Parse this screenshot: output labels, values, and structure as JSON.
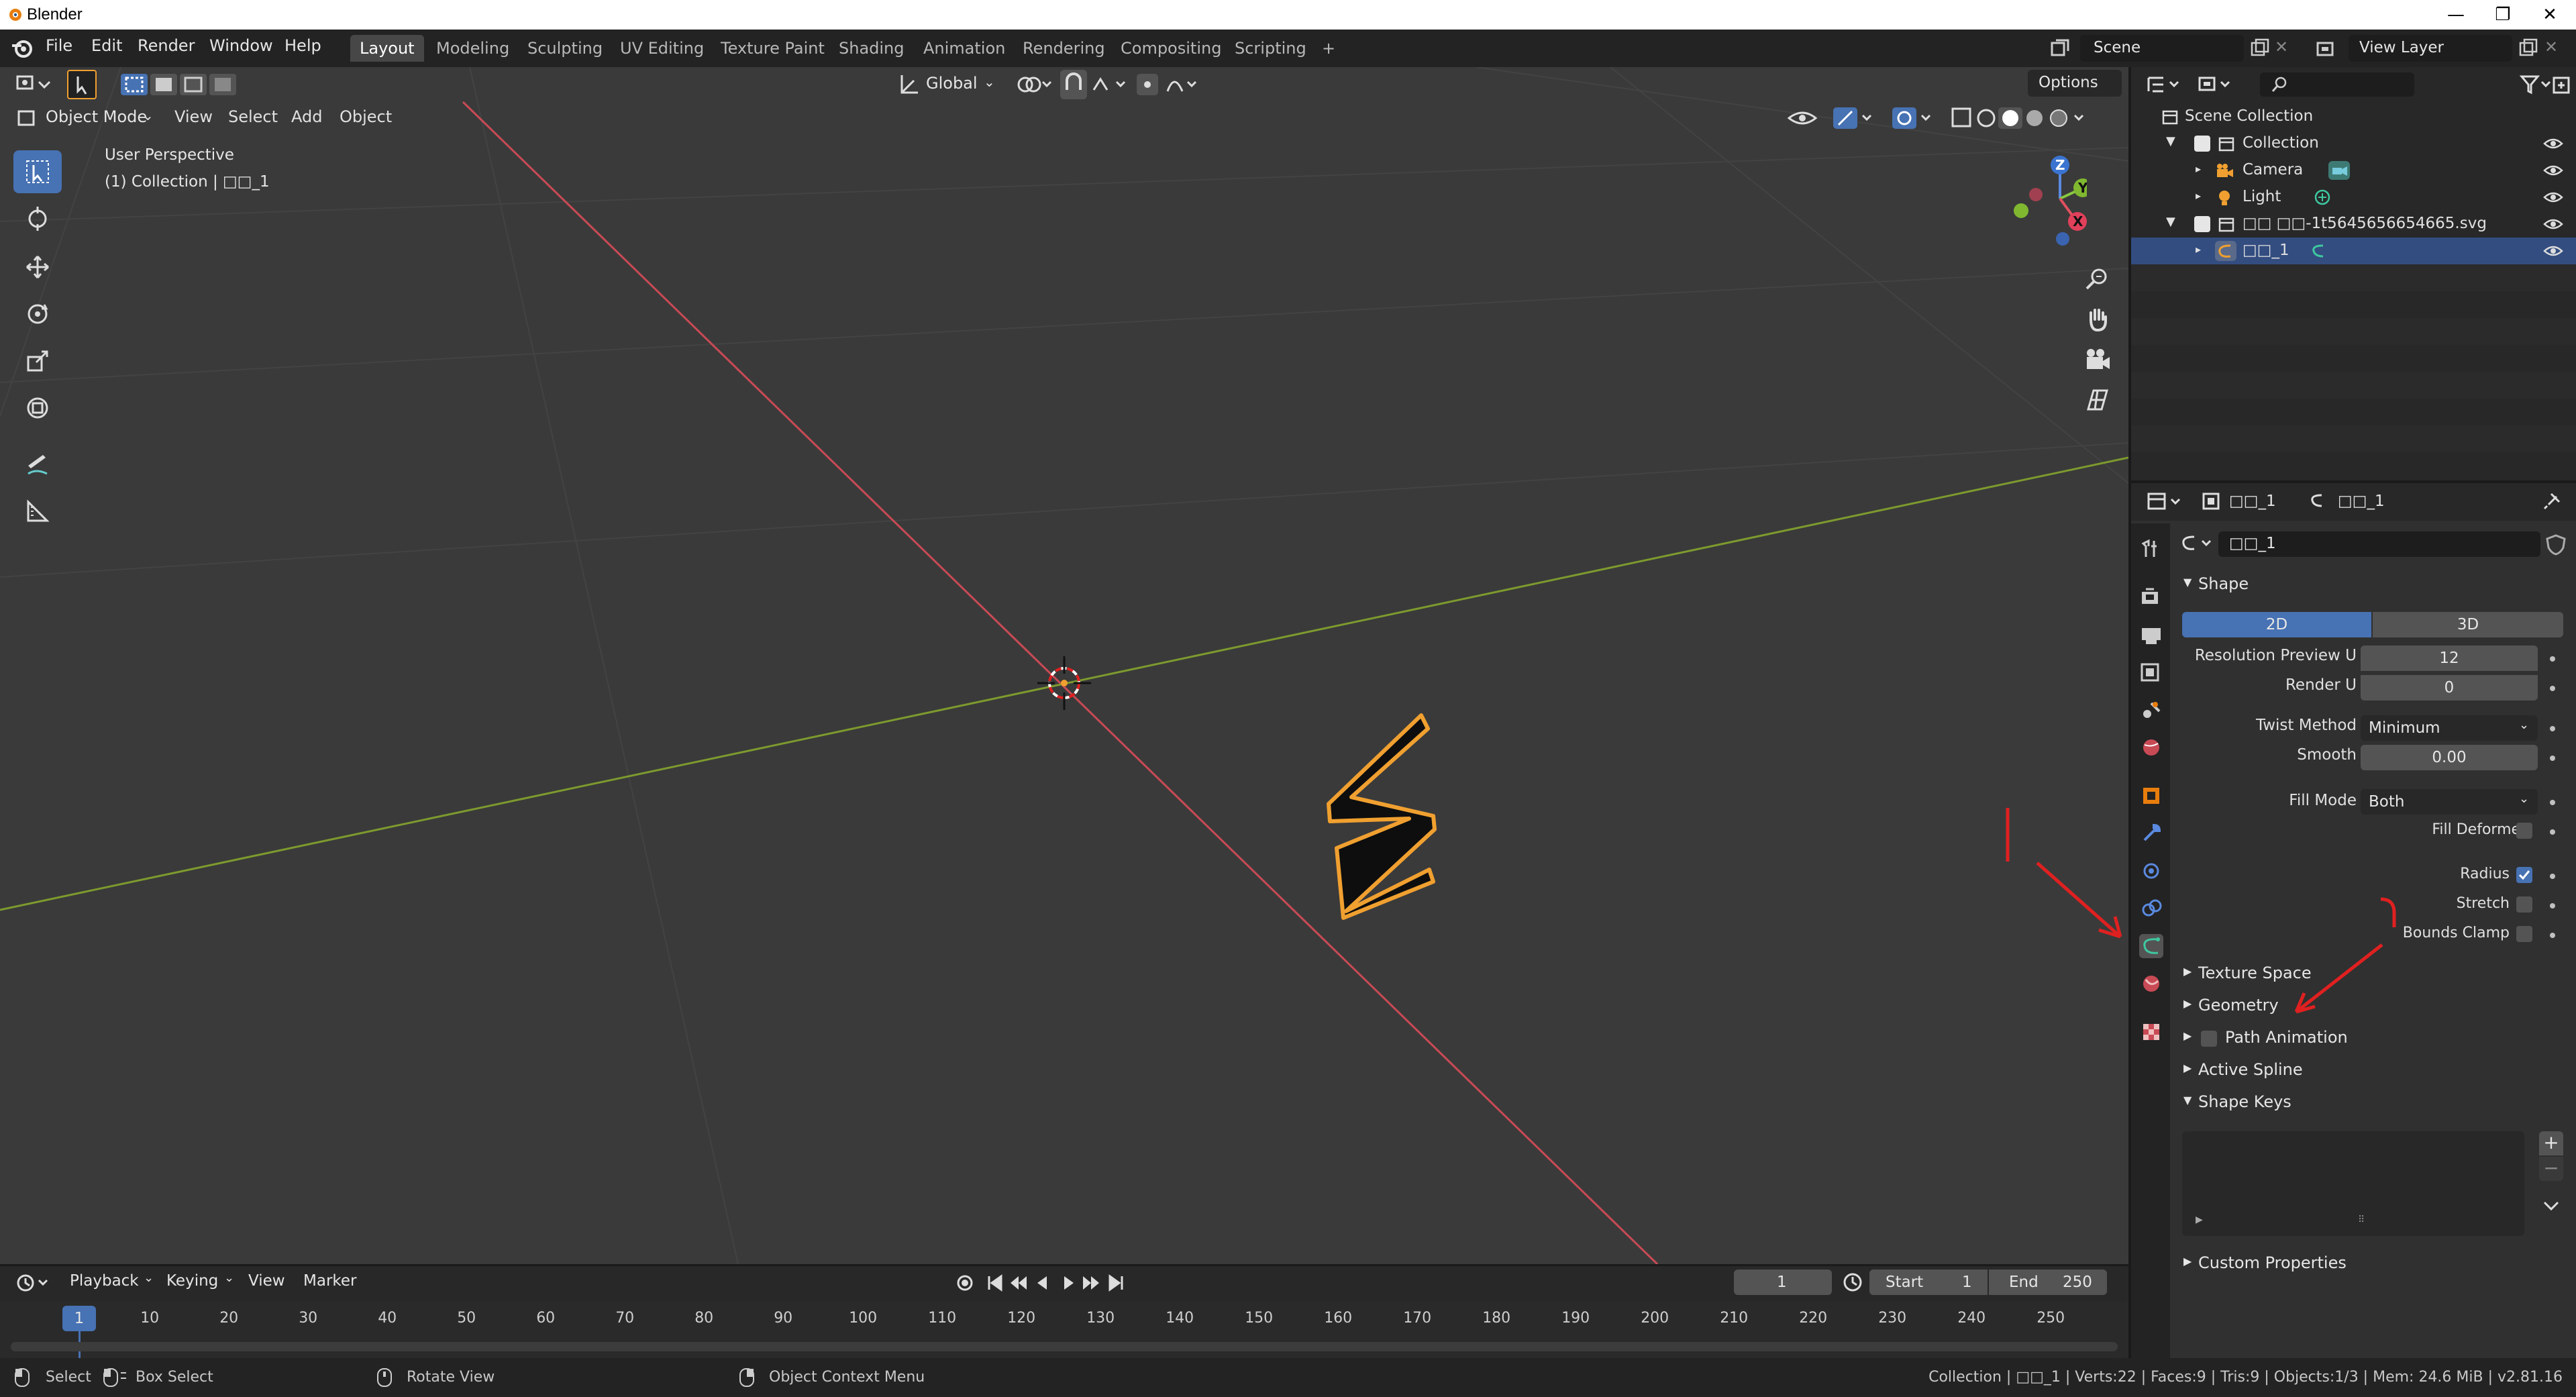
{
  "window": {
    "title": "Blender",
    "minimize": "—",
    "restore": "❐",
    "close": "✕"
  },
  "menu": [
    "File",
    "Edit",
    "Render",
    "Window",
    "Help"
  ],
  "workspaces": [
    "Layout",
    "Modeling",
    "Sculpting",
    "UV Editing",
    "Texture Paint",
    "Shading",
    "Animation",
    "Rendering",
    "Compositing",
    "Scripting",
    "+"
  ],
  "scene": {
    "name": "Scene",
    "view_layer": "View Layer"
  },
  "viewport": {
    "transform_orientation": "Global",
    "options": "Options",
    "mode": "Object Mode",
    "menus": [
      "View",
      "Select",
      "Add",
      "Object"
    ],
    "overlay_title": "User Perspective",
    "overlay_sub": "(1) Collection | □□_1",
    "gizmo": {
      "z": "Z",
      "y": "Y",
      "x": "X"
    }
  },
  "outliner": {
    "rows": [
      {
        "label": "Scene Collection"
      },
      {
        "label": "Collection"
      },
      {
        "label": "Camera"
      },
      {
        "label": "Light"
      },
      {
        "label": "□□ □□-1t5645656654665.svg"
      },
      {
        "label": "□□_1"
      }
    ]
  },
  "properties": {
    "header_object": "□□_1",
    "header_data": "□□_1",
    "datablock": "□□_1",
    "shape": {
      "title": "Shape",
      "dim_2d": "2D",
      "dim_3d": "3D",
      "res_preview_label": "Resolution Preview U",
      "res_preview_value": "12",
      "render_u_label": "Render U",
      "render_u_value": "0",
      "twist_label": "Twist Method",
      "twist_value": "Minimum",
      "smooth_label": "Smooth",
      "smooth_value": "0.00",
      "fill_mode_label": "Fill Mode",
      "fill_mode_value": "Both",
      "fill_deformed_label": "Fill Deformed",
      "radius_label": "Radius",
      "stretch_label": "Stretch",
      "bounds_clamp_label": "Bounds Clamp"
    },
    "panels": [
      "Texture Space",
      "Geometry",
      "Path Animation",
      "Active Spline",
      "Shape Keys",
      "Custom Properties"
    ],
    "shape_keys_add": "+",
    "shape_keys_remove": "−"
  },
  "timeline": {
    "menus": [
      "Playback",
      "Keying",
      "View",
      "Marker"
    ],
    "current_frame": "1",
    "start_label": "Start",
    "start_value": "1",
    "end_label": "End",
    "end_value": "250",
    "ticks": [
      "10",
      "20",
      "30",
      "40",
      "50",
      "60",
      "70",
      "80",
      "90",
      "100",
      "110",
      "120",
      "130",
      "140",
      "150",
      "160",
      "170",
      "180",
      "190",
      "200",
      "210",
      "220",
      "230",
      "240",
      "250"
    ],
    "cursor": "1"
  },
  "statusbar": {
    "select": "Select",
    "box_select": "Box Select",
    "rotate_view": "Rotate View",
    "context_menu": "Object Context Menu",
    "stats": "Collection | □□_1 | Verts:22 | Faces:9 | Tris:9 | Objects:1/3 | Mem: 24.6 MiB | v2.81.16"
  },
  "colors": {
    "accent_blue": "#4772b3",
    "x_axis": "#c84a55",
    "y_axis": "#7d9a2e",
    "curve_outline": "#f0a030",
    "annotation_red": "#e02020"
  }
}
